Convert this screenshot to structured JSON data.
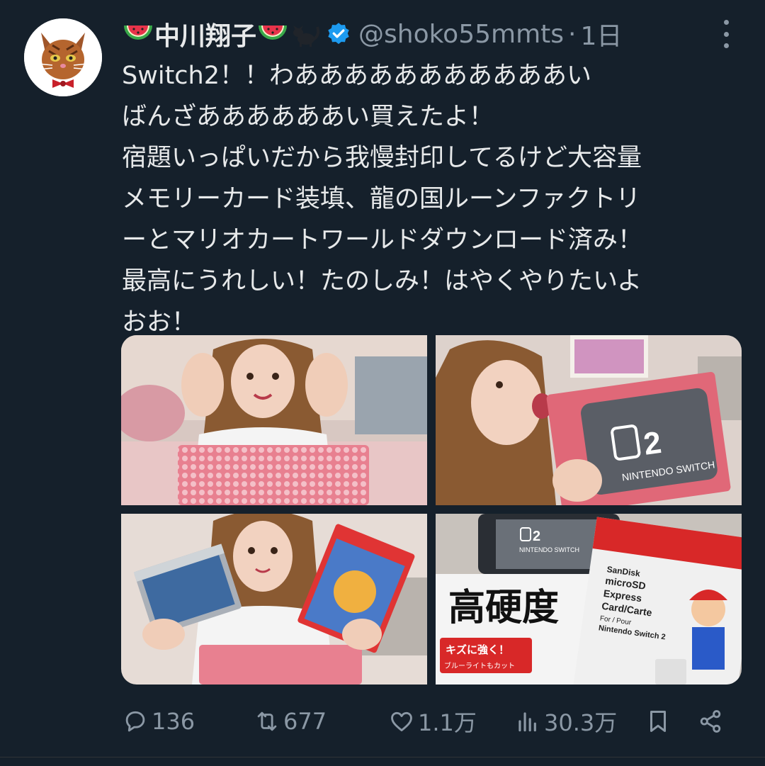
{
  "author": {
    "display_name": "中川翔子",
    "handle": "@shoko55mmts",
    "separator": "·",
    "time": "1日",
    "name_emojis": [
      "watermelon-emoji",
      "watermelon-emoji",
      "black-cat-emoji"
    ],
    "verified": true
  },
  "tweet": {
    "lines": [
      "Switch2！！わあああああああああああい",
      "ばんざああああああい買えたよ！",
      "宿題いっぱいだから我慢封印してるけど大容量",
      "メモリーカード装填、龍の国ルーンファクトリ",
      "ーとマリオカートワールドダウンロード済み！",
      "最高にうれしい！たのしみ！はやくやりたいよ",
      "おお！"
    ]
  },
  "photos": [
    {
      "label": ""
    },
    {
      "label": "NINTENDO SWITCH"
    },
    {
      "label": ""
    },
    {
      "label_top": "NINTENDO SWITCH",
      "sandisk_lines": [
        "SanDisk",
        "microSD",
        "Express",
        "Card/Carte",
        "For / Pour",
        "Nintendo Switch 2"
      ],
      "big_text": "高硬度",
      "sub_text": "キズに強く！",
      "sub_text2": "ブルーライトもカット"
    }
  ],
  "actions": {
    "replies": "136",
    "retweets": "677",
    "likes": "1.1万",
    "views": "30.3万"
  },
  "colors": {
    "background": "#15202b",
    "text": "#e7e9ea",
    "secondary": "#8b98a5",
    "verified": "#1d9bf0"
  }
}
